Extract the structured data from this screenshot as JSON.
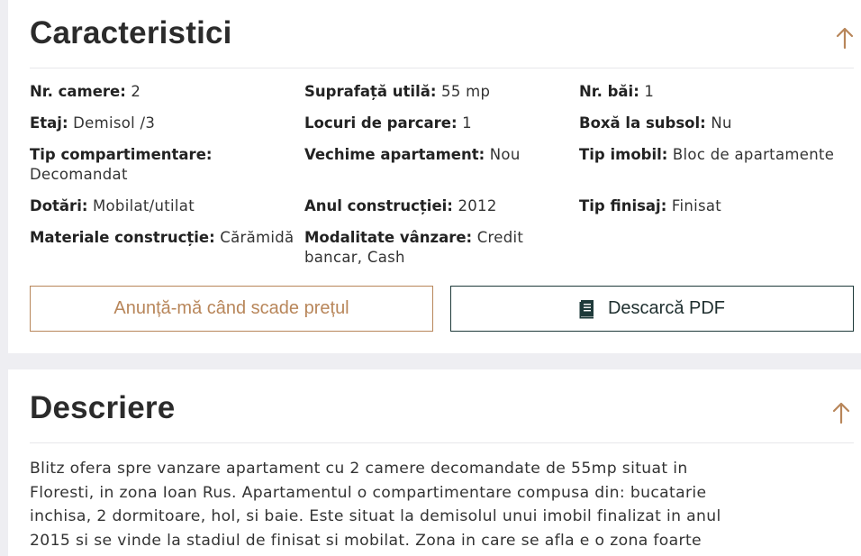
{
  "characteristics": {
    "title": "Caracteristici",
    "specs": [
      {
        "key": "Nr. camere:",
        "value": "2"
      },
      {
        "key": "Suprafață utilă:",
        "value": "55 mp"
      },
      {
        "key": "Nr. băi:",
        "value": "1"
      },
      {
        "key": "Etaj:",
        "value": "Demisol /3"
      },
      {
        "key": "Locuri de parcare:",
        "value": "1"
      },
      {
        "key": "Boxă la subsol:",
        "value": "Nu"
      },
      {
        "key": "Tip compartimentare:",
        "value": "Decomandat"
      },
      {
        "key": "Vechime apartament:",
        "value": "Nou"
      },
      {
        "key": "Tip imobil:",
        "value": "Bloc de apartamente"
      },
      {
        "key": "Dotări:",
        "value": "Mobilat/utilat"
      },
      {
        "key": "Anul construcției:",
        "value": "2012"
      },
      {
        "key": "Tip finisaj:",
        "value": "Finisat"
      },
      {
        "key": "Materiale construcție:",
        "value": "Cărămidă"
      },
      {
        "key": "Modalitate vânzare:",
        "value": "Credit bancar, Cash"
      }
    ],
    "alert_button_label": "Anunță-mă când scade prețul",
    "pdf_button_label": "Descarcă PDF"
  },
  "description": {
    "title": "Descriere",
    "lines": [
      "Blitz ofera spre vanzare apartament cu 2 camere decomandate de 55mp situat in",
      "Floresti, in zona Ioan Rus. Apartamentul o compartimentare compusa din: bucatarie",
      "inchisa, 2 dormitoare, hol, si baie. Este situat la demisolul unui imobil finalizat in anul",
      "2015 si se vinde la stadiul de finisat si mobilat. Zona in care se afla e o zona foarte"
    ]
  },
  "colors": {
    "accent": "#b8865a",
    "dark_button": "#1e3a3a",
    "background": "#eeeef2"
  },
  "icons": {
    "collapse": "arrow-up-icon",
    "pdf": "document-icon"
  }
}
